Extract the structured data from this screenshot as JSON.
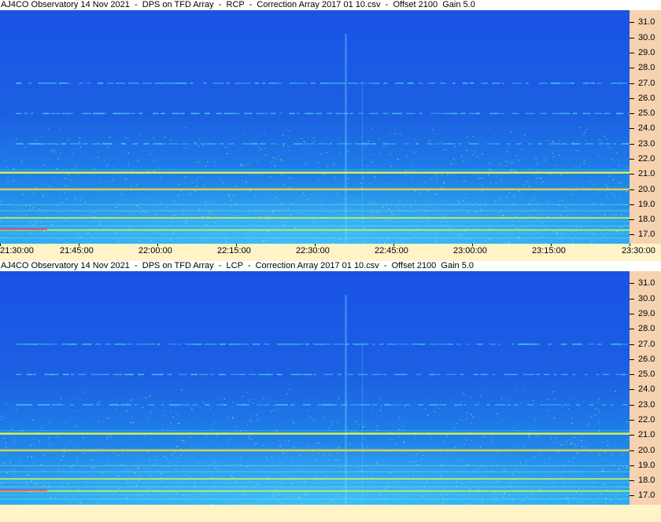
{
  "panels": [
    {
      "title": "AJ4CO Observatory 14 Nov 2021  -  DPS on TFD Array  -  RCP  -  Correction Array 2017 01 10.csv  -  Offset 2100  Gain 5.0"
    },
    {
      "title": "AJ4CO Observatory 14 Nov 2021  -  DPS on TFD Array  -  LCP  -  Correction Array 2017 01 10.csv  -  Offset 2100  Gain 5.0"
    }
  ],
  "freq_ticks": [
    "31.0",
    "30.0",
    "29.0",
    "28.0",
    "27.0",
    "26.0",
    "25.0",
    "24.0",
    "23.0",
    "22.0",
    "21.0",
    "20.0",
    "19.0",
    "18.0",
    "17.0"
  ],
  "time_ticks": [
    "21:30:00",
    "21:45:00",
    "22:00:00",
    "22:15:00",
    "22:30:00",
    "22:45:00",
    "23:00:00",
    "23:15:00",
    "23:30:00"
  ],
  "colors": {
    "background": "#1f5fe0",
    "scale_bg": "#f6d2b0",
    "axis_bg": "#fff3c8",
    "band_cyan": "#4ad2ff",
    "band_yellow": "#e8ff40",
    "band_red": "#ff3060"
  },
  "chart_data": {
    "type": "heatmap",
    "description_axes": {
      "x_range": [
        "21:30:00",
        "23:30:00"
      ],
      "y_range_mhz": [
        16.4,
        31.8
      ],
      "y_ticks_mhz": [
        17,
        18,
        19,
        20,
        21,
        22,
        23,
        24,
        25,
        26,
        27,
        28,
        29,
        30,
        31
      ]
    },
    "panels": [
      "RCP",
      "LCP"
    ],
    "strong_bands_mhz": [
      {
        "freq": 21.1,
        "level": "strong"
      },
      {
        "freq": 20.0,
        "level": "strong"
      },
      {
        "freq": 18.1,
        "level": "medium"
      },
      {
        "freq": 17.3,
        "level": "medium"
      },
      {
        "freq": 27.0,
        "level": "weak"
      },
      {
        "freq": 25.0,
        "level": "weak"
      },
      {
        "freq": 23.0,
        "level": "weak"
      }
    ]
  }
}
